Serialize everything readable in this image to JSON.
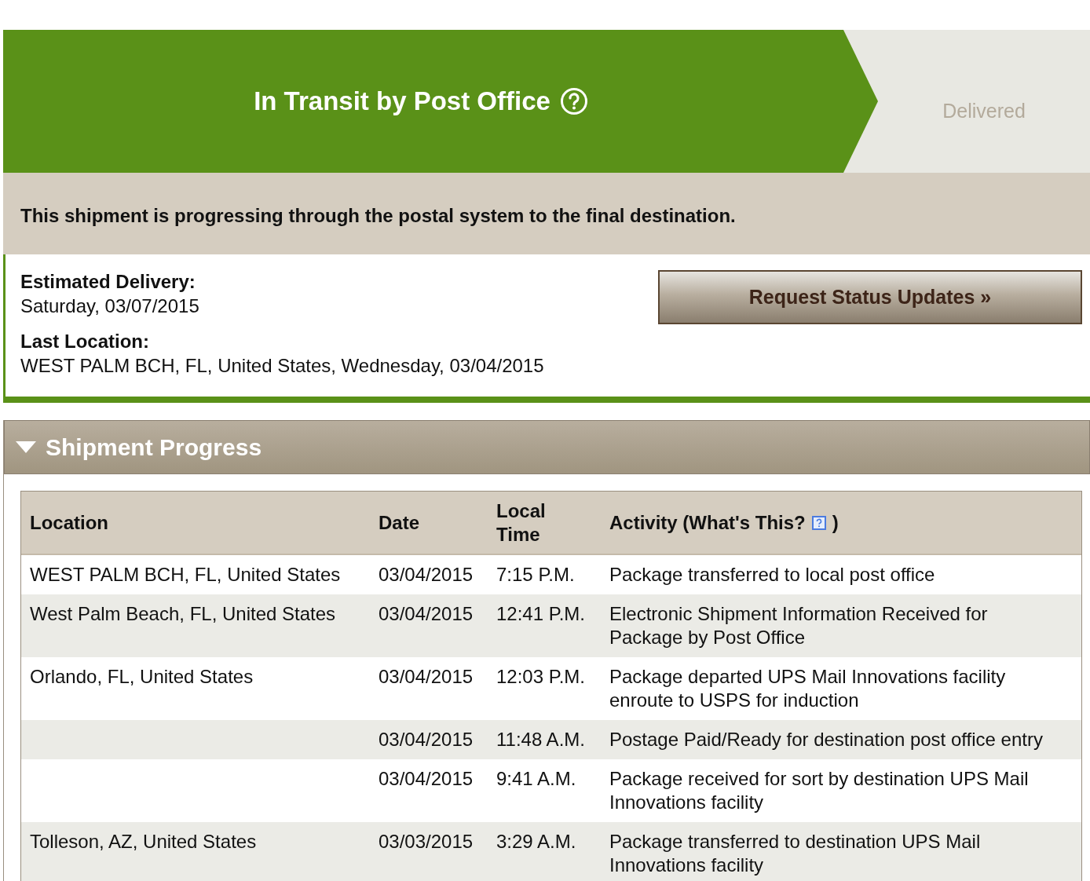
{
  "steps": [
    {
      "label": "In Transit by Post Office",
      "selected": true,
      "help": true
    },
    {
      "label": "Delivered",
      "selected": false
    }
  ],
  "status_message": "This shipment is progressing through the postal system to the final destination.",
  "details": [
    {
      "label": "Estimated Delivery:",
      "value": "Saturday, 03/07/2015"
    },
    {
      "label": "Last Location:",
      "value": "WEST PALM BCH, FL, United States, Wednesday, 03/04/2015"
    }
  ],
  "request_button": "Request Status Updates »",
  "progress": {
    "title": "Shipment Progress",
    "expanded": true,
    "columns": [
      "Location",
      "Date",
      "Local Time",
      "Activity (What's This?"
    ],
    "columns_suffix": ")",
    "rows": [
      {
        "location": "WEST PALM BCH, FL, United States",
        "date": "03/04/2015",
        "time": "7:15 P.M.",
        "activity": "Package transferred to local post office"
      },
      {
        "location": "West Palm Beach, FL, United States",
        "date": "03/04/2015",
        "time": "12:41 P.M.",
        "activity": "Electronic Shipment Information Received for Package by Post Office"
      },
      {
        "location": "Orlando, FL, United States",
        "date": "03/04/2015",
        "time": "12:03 P.M.",
        "activity": "Package departed UPS Mail Innovations facility enroute to USPS for induction"
      },
      {
        "date": "03/04/2015",
        "time": "11:48 A.M.",
        "activity": "Postage Paid/Ready for destination post office entry"
      },
      {
        "date": "03/04/2015",
        "time": "9:41 A.M.",
        "activity": "Package received for sort by destination UPS Mail Innovations facility"
      },
      {
        "location": "Tolleson, AZ, United States",
        "date": "03/03/2015",
        "time": "3:29 A.M.",
        "activity": "Package transferred to destination UPS Mail Innovations facility"
      }
    ]
  }
}
